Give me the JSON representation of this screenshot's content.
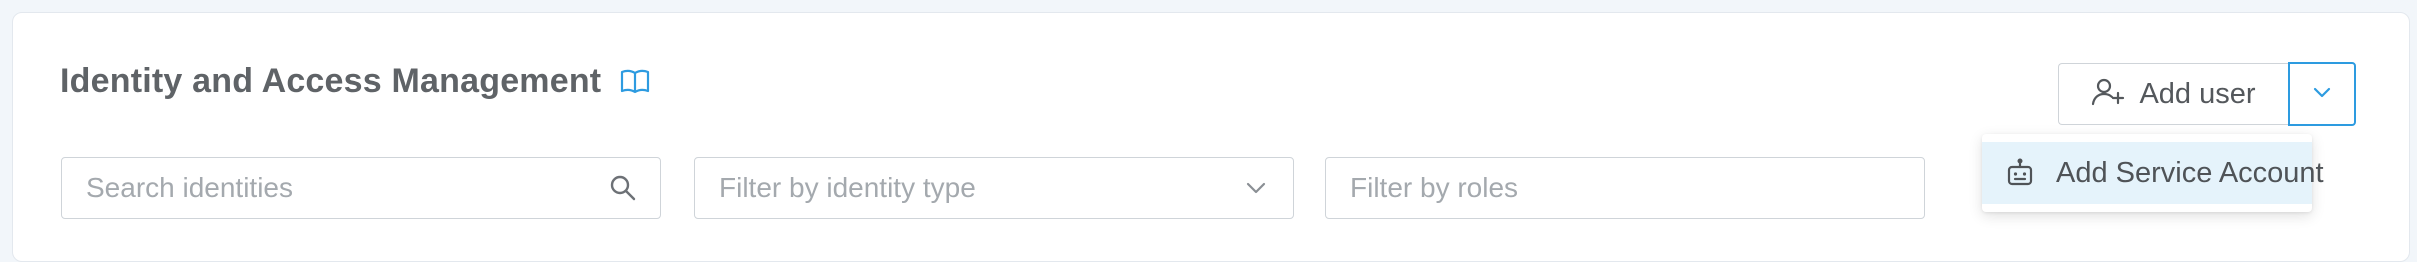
{
  "header": {
    "title": "Identity and Access Management",
    "docs_icon": "book-open-icon"
  },
  "filters": {
    "search": {
      "placeholder": "Search identities",
      "value": "",
      "icon": "search-icon"
    },
    "identity_type": {
      "placeholder": "Filter by identity type",
      "icon": "chevron-down-icon"
    },
    "roles": {
      "placeholder": "Filter by roles"
    }
  },
  "actions": {
    "add_user_label": "Add user",
    "add_user_icon": "user-plus-icon",
    "dropdown_icon": "chevron-down-icon",
    "menu": [
      {
        "label": "Add Service Account",
        "icon": "robot-icon",
        "highlighted": true
      }
    ]
  },
  "colors": {
    "accent": "#2d9be0",
    "menu_highlight": "#e5f3fb",
    "title": "#5f6367"
  }
}
